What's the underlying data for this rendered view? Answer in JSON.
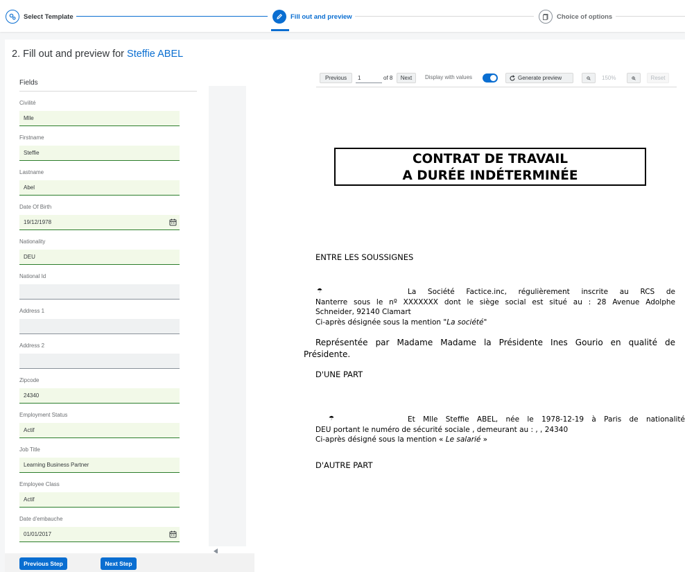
{
  "wizard": {
    "steps": [
      {
        "label": "Select Template",
        "state": "done",
        "icon": "gear-icon"
      },
      {
        "label": "Fill out and preview",
        "state": "active",
        "icon": "pencil-icon"
      },
      {
        "label": "Choice of options",
        "state": "todo",
        "icon": "document-icon"
      }
    ]
  },
  "page": {
    "title_prefix": "2. Fill out and preview for",
    "title_name": "Steffie ABEL"
  },
  "fields": {
    "header": "Fields",
    "items": [
      {
        "label": "Civilité",
        "value": "Mlle"
      },
      {
        "label": "Firstname",
        "value": "Steffie"
      },
      {
        "label": "Lastname",
        "value": "Abel"
      },
      {
        "label": "Date Of Birth",
        "value": "19/12/1978"
      },
      {
        "label": "Nationality",
        "value": "DEU"
      },
      {
        "label": "National Id",
        "value": ""
      },
      {
        "label": "Address 1",
        "value": ""
      },
      {
        "label": "Address 2",
        "value": ""
      },
      {
        "label": "Zipcode",
        "value": "24340"
      },
      {
        "label": "Employment Status",
        "value": "Actif"
      },
      {
        "label": "Job Title",
        "value": "Learning Business Partner"
      },
      {
        "label": "Employee Class",
        "value": "Actif"
      },
      {
        "label": "Date d'embauche",
        "value": "01/01/2017"
      }
    ]
  },
  "footer": {
    "previous_label": "Previous Step",
    "next_label": "Next Step"
  },
  "toolbar": {
    "previous_label": "Previous",
    "page_value": "1",
    "page_of": "of 8",
    "next_label": "Next",
    "display_values_label": "Display with values",
    "display_values_on": true,
    "generate_label": "Generate preview",
    "zoom_value": "150%",
    "reset_label": "Reset"
  },
  "document": {
    "title_line1": "CONTRAT DE TRAVAIL",
    "title_line2": "A DURÉE INDÉTERMINÉE",
    "heading_parties": "ENTRE LES SOUSSIGNES",
    "company_l1": "La  Société  Factice.inc,  régulièrement   inscrite  au  RCS  de",
    "company_l2": "Nanterre  sous le nº XXXXXXX dont le siège social est situé au : 28 Avenue Adolphe",
    "company_l3": "Schneider, 92140 Clamart",
    "company_l4_prefix": "Ci-après désignée sous la mention \"",
    "company_l4_em": "La société",
    "company_l4_suffix": "\"",
    "represented_l1": "Représentée par Madame Madame la Présidente Ines Gourio en qualité de",
    "represented_l2": "Présidente.",
    "heading_one_part": "D'UNE PART",
    "employee_l1": "Et Mlle  Steffie ABEL, née le 1978-12-19 à Paris de nationalité",
    "employee_l2": "DEU portant le numéro  de sécurité sociale , demeurant au : , , 24340",
    "employee_l3_prefix": "Ci-après désigné sous la mention « ",
    "employee_l3_em": "Le salarié",
    "employee_l3_suffix": " »",
    "heading_other_part": "D'AUTRE PART"
  },
  "colors": {
    "accent": "#0a6ed1",
    "filled_field_bg": "#f2f9e8",
    "filled_field_border": "#2b7d2b",
    "empty_field_bg": "#eff1f2"
  }
}
